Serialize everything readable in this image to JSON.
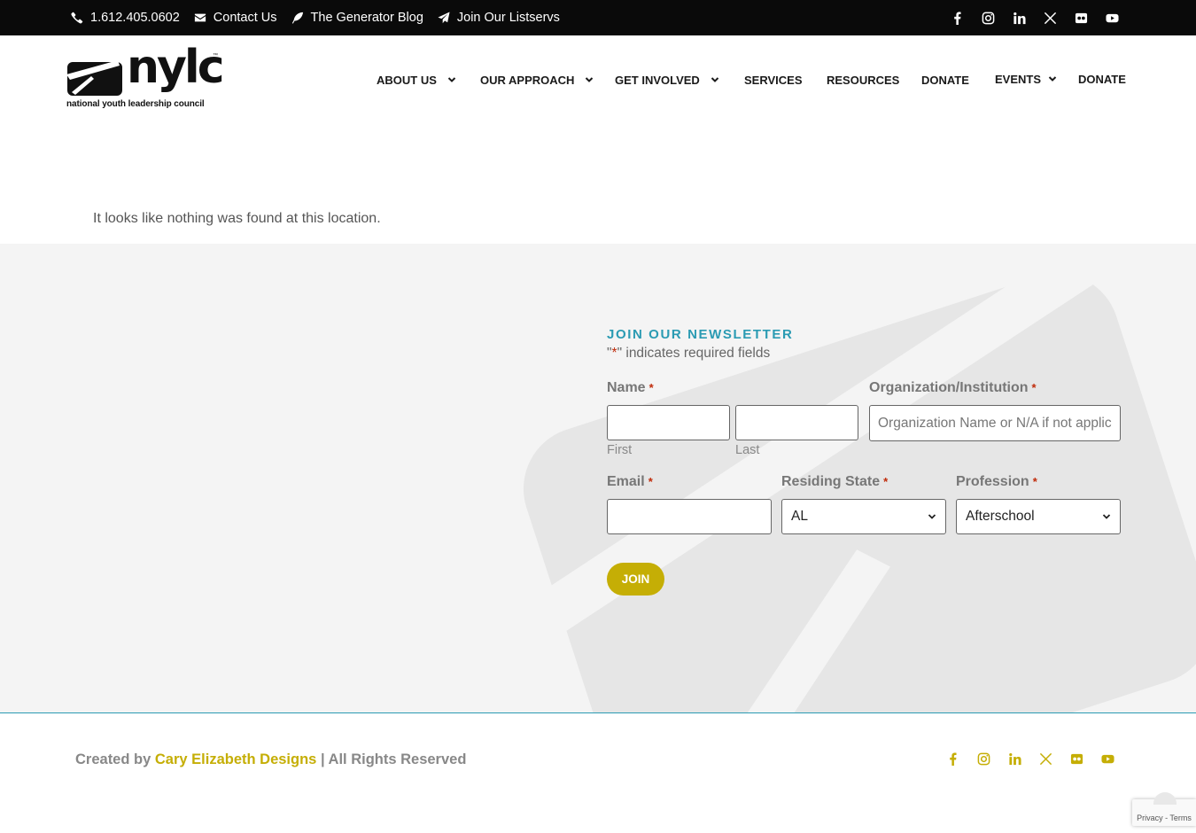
{
  "topbar": {
    "phone": "1.612.405.0602",
    "contact": "Contact Us",
    "blog": "The Generator Blog",
    "listservs": "Join Our Listservs",
    "social": [
      "facebook-icon",
      "instagram-icon",
      "linkedin-icon",
      "x-icon",
      "flickr-icon",
      "youtube-icon"
    ]
  },
  "header": {
    "logo_word": "nylc",
    "logo_tm": "™",
    "logo_tagline": "national youth leadership council",
    "nav": [
      {
        "label": "About Us",
        "dropdown": true
      },
      {
        "label": "Our Approach",
        "dropdown": true
      },
      {
        "label": "Get Involved",
        "dropdown": true
      },
      {
        "label": "Services",
        "dropdown": false
      },
      {
        "label": "Resources",
        "dropdown": false
      },
      {
        "label": "Donate",
        "dropdown": false
      },
      {
        "label": "Events",
        "dropdown": true
      },
      {
        "label": "Donate",
        "dropdown": false
      }
    ]
  },
  "main": {
    "message": "It looks like nothing was found at this location."
  },
  "newsletter": {
    "title": "JOIN OUR NEWSLETTER",
    "required_prefix": "\"",
    "required_star": "*",
    "required_suffix": "\" indicates required fields",
    "name_label": "Name",
    "req_mark": "*",
    "first_sub": "First",
    "last_sub": "Last",
    "first_value": "",
    "last_value": "",
    "org_label": "Organization/Institution",
    "org_placeholder": "Organization Name or N/A if not applicable",
    "email_label": "Email",
    "email_value": "",
    "state_label": "Residing State",
    "state_value": "AL",
    "profession_label": "Profession",
    "profession_value": "Afterschool",
    "join_label": "JOIN"
  },
  "footer": {
    "created_prefix": "Created by ",
    "created_link": "Cary Elizabeth Designs",
    "created_suffix": " | All Rights Reserved",
    "recaptcha": "Privacy - Terms"
  },
  "colors": {
    "topbar_bg": "#0a0a0a",
    "accent_teal": "#2b9bb3",
    "accent_gold": "#c5ae05",
    "required_red": "#c02b0a",
    "section_bg": "#f4f4f4"
  }
}
